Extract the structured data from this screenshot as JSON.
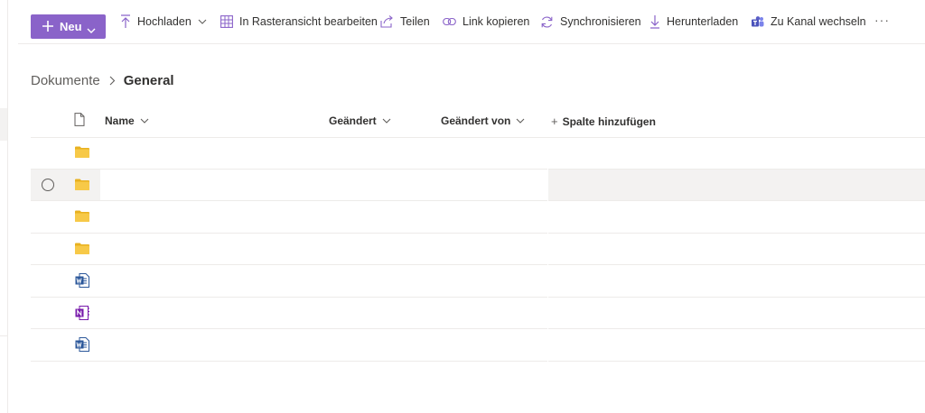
{
  "toolbar": {
    "new_label": "Neu",
    "upload_label": "Hochladen",
    "grid_edit_label": "In Rasteransicht bearbeiten",
    "share_label": "Teilen",
    "copy_link_label": "Link kopieren",
    "sync_label": "Synchronisieren",
    "download_label": "Herunterladen",
    "switch_channel_label": "Zu Kanal wechseln",
    "more_label": "···"
  },
  "breadcrumb": {
    "parent": "Dokumente",
    "current": "General"
  },
  "table": {
    "columns": {
      "name": "Name",
      "modified": "Geändert",
      "modified_by": "Geändert von",
      "add_column": "Spalte hinzufügen",
      "add_column_symbol": "+"
    },
    "rows": [
      {
        "type": "folder-icon"
      },
      {
        "type": "folder-icon",
        "state": "hover"
      },
      {
        "type": "folder-icon"
      },
      {
        "type": "folder-icon"
      },
      {
        "type": "word-doc-icon"
      },
      {
        "type": "onenote-icon"
      },
      {
        "type": "word-doc-icon"
      }
    ]
  },
  "colors": {
    "accent": "#8a63c9",
    "folder": "#f7c948",
    "word": "#2b579a",
    "onenote": "#7719aa",
    "teams": "#5b5fc7"
  }
}
